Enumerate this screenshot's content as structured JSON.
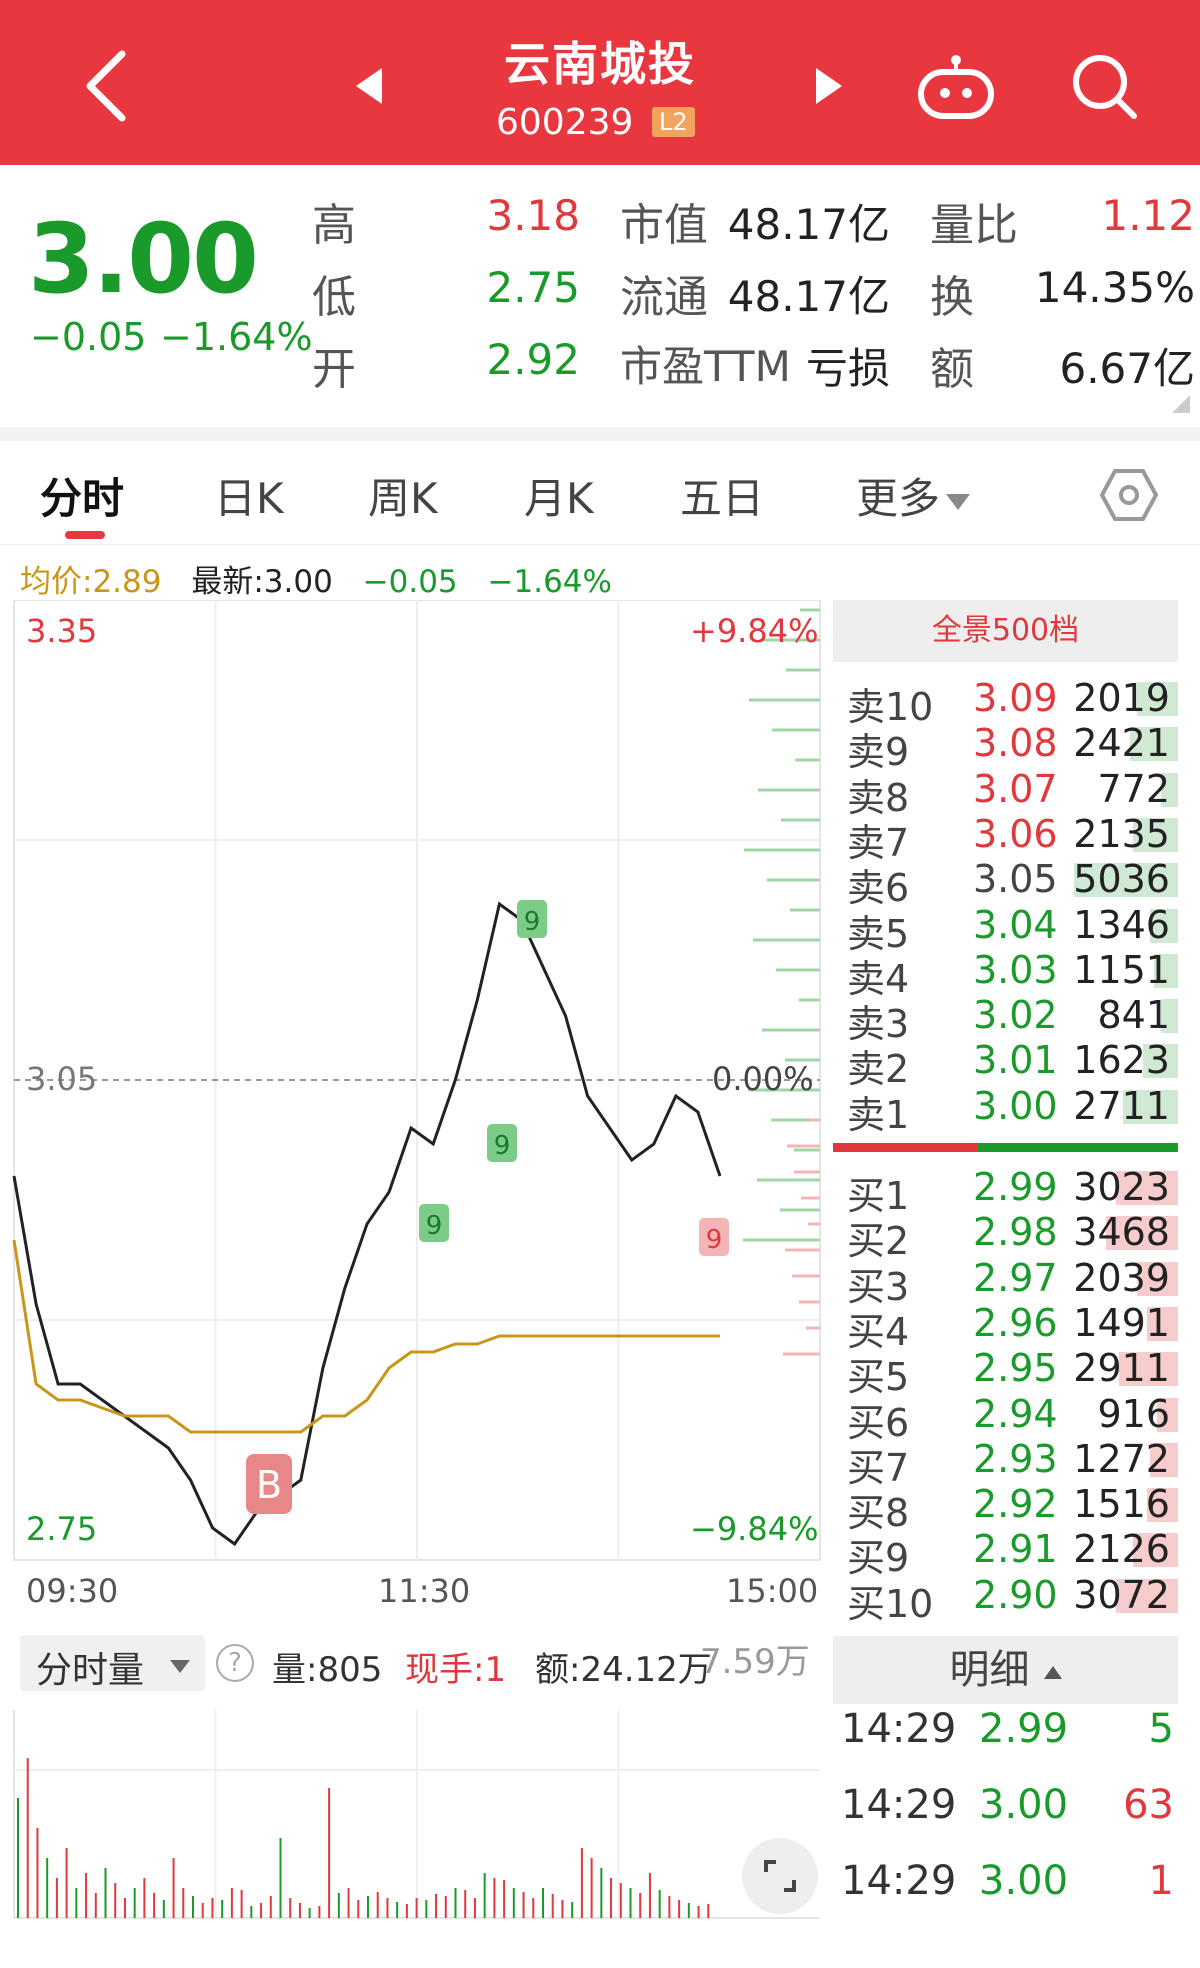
{
  "header": {
    "title": "云南城投",
    "code": "600239",
    "level_badge": "L2",
    "icons": [
      "back-icon",
      "prev-icon",
      "next-icon",
      "robot-icon",
      "search-icon"
    ]
  },
  "quote": {
    "price": "3.00",
    "change": "−0.05",
    "change_pct": "−1.64%",
    "high_label": "高",
    "high": "3.18",
    "low_label": "低",
    "low": "2.75",
    "open_label": "开",
    "open": "2.92",
    "mcap_label": "市值",
    "mcap": "48.17亿",
    "float_label": "流通",
    "float": "48.17亿",
    "pe_label": "市盈TTM",
    "pe": "亏损",
    "volratio_label": "量比",
    "volratio": "1.12",
    "turnover_label": "换",
    "turnover": "14.35%",
    "amount_label": "额",
    "amount": "6.67亿",
    "colors": {
      "up": "#e0383c",
      "down": "#1a9a2a",
      "brand": "#e8373f"
    }
  },
  "tabs": {
    "items": [
      "分时",
      "日K",
      "周K",
      "月K",
      "五日",
      "更多"
    ],
    "active": "分时"
  },
  "intraday_info": {
    "avg": "均价:2.89",
    "latest": "最新:3.00",
    "change": "−0.05",
    "change_pct": "−1.64%"
  },
  "chart": {
    "y_top": "3.35",
    "y_mid": "3.05",
    "y_bottom": "2.75",
    "pct_top": "+9.84%",
    "pct_mid": "0.00%",
    "pct_bottom": "−9.84%",
    "x_labels": [
      "09:30",
      "11:30",
      "15:00"
    ],
    "marker_buy": "B",
    "signal_label": "9"
  },
  "chart_data": {
    "type": "line",
    "x_labels": [
      "09:30",
      "11:30",
      "15:00"
    ],
    "ylim": [
      2.75,
      3.35
    ],
    "prev_close": 3.05,
    "series": [
      {
        "values": [
          2.99,
          2.91,
          2.86,
          2.86,
          2.85,
          2.84,
          2.83,
          2.82,
          2.8,
          2.77,
          2.76,
          2.78,
          2.79,
          2.8,
          2.87,
          2.92,
          2.96,
          2.98,
          3.02,
          3.01,
          3.05,
          3.1,
          3.16,
          3.15,
          3.12,
          3.09,
          3.04,
          3.02,
          3.0,
          3.01,
          3.04,
          3.03,
          2.99
        ]
      },
      {
        "values": [
          2.95,
          2.86,
          2.85,
          2.85,
          2.845,
          2.84,
          2.84,
          2.84,
          2.83,
          2.83,
          2.83,
          2.83,
          2.83,
          2.83,
          2.84,
          2.84,
          2.85,
          2.87,
          2.88,
          2.88,
          2.885,
          2.885,
          2.89,
          2.89,
          2.89,
          2.89,
          2.89,
          2.89,
          2.89,
          2.89,
          2.89,
          2.89,
          2.89
        ]
      }
    ]
  },
  "order_book": {
    "title": "全景500档",
    "asks": [
      {
        "label": "卖10",
        "price": "3.09",
        "vol": "2019",
        "color": "#e0383c",
        "depth": 0.12
      },
      {
        "label": "卖9",
        "price": "3.08",
        "vol": "2421",
        "color": "#e0383c",
        "depth": 0.14
      },
      {
        "label": "卖8",
        "price": "3.07",
        "vol": "772",
        "color": "#e0383c",
        "depth": 0.05
      },
      {
        "label": "卖7",
        "price": "3.06",
        "vol": "2135",
        "color": "#e0383c",
        "depth": 0.13
      },
      {
        "label": "卖6",
        "price": "3.05",
        "vol": "5036",
        "color": "#444444",
        "depth": 0.3
      },
      {
        "label": "卖5",
        "price": "3.04",
        "vol": "1346",
        "color": "#1a9a2a",
        "depth": 0.08
      },
      {
        "label": "卖4",
        "price": "3.03",
        "vol": "1151",
        "color": "#1a9a2a",
        "depth": 0.07
      },
      {
        "label": "卖3",
        "price": "3.02",
        "vol": "841",
        "color": "#1a9a2a",
        "depth": 0.05
      },
      {
        "label": "卖2",
        "price": "3.01",
        "vol": "1623",
        "color": "#1a9a2a",
        "depth": 0.1
      },
      {
        "label": "卖1",
        "price": "3.00",
        "vol": "2711",
        "color": "#1a9a2a",
        "depth": 0.16
      }
    ],
    "bids": [
      {
        "label": "买1",
        "price": "2.99",
        "vol": "3023",
        "color": "#1a9a2a",
        "depth": 0.18
      },
      {
        "label": "买2",
        "price": "2.98",
        "vol": "3468",
        "color": "#1a9a2a",
        "depth": 0.21
      },
      {
        "label": "买3",
        "price": "2.97",
        "vol": "2039",
        "color": "#1a9a2a",
        "depth": 0.12
      },
      {
        "label": "买4",
        "price": "2.96",
        "vol": "1491",
        "color": "#1a9a2a",
        "depth": 0.09
      },
      {
        "label": "买5",
        "price": "2.95",
        "vol": "2911",
        "color": "#1a9a2a",
        "depth": 0.17
      },
      {
        "label": "买6",
        "price": "2.94",
        "vol": "916",
        "color": "#1a9a2a",
        "depth": 0.06
      },
      {
        "label": "买7",
        "price": "2.93",
        "vol": "1272",
        "color": "#1a9a2a",
        "depth": 0.08
      },
      {
        "label": "买8",
        "price": "2.92",
        "vol": "1516",
        "color": "#1a9a2a",
        "depth": 0.09
      },
      {
        "label": "买9",
        "price": "2.91",
        "vol": "2126",
        "color": "#1a9a2a",
        "depth": 0.13
      },
      {
        "label": "买10",
        "price": "2.90",
        "vol": "3072",
        "color": "#1a9a2a",
        "depth": 0.18
      }
    ]
  },
  "volume": {
    "dropdown": "分时量",
    "help": "?",
    "vol": "量:805",
    "hand": "现手:1",
    "amount": "额:24.12万",
    "scale": "7.59万"
  },
  "detail": {
    "title": "明细",
    "trades": [
      {
        "time": "14:29",
        "price": "2.99",
        "vol": "5",
        "color": "#1a9a2a",
        "vcolor": "#1a9a2a"
      },
      {
        "time": "14:29",
        "price": "3.00",
        "vol": "63",
        "color": "#1a9a2a",
        "vcolor": "#e0383c"
      },
      {
        "time": "14:29",
        "price": "3.00",
        "vol": "1",
        "color": "#1a9a2a",
        "vcolor": "#e0383c"
      }
    ]
  }
}
